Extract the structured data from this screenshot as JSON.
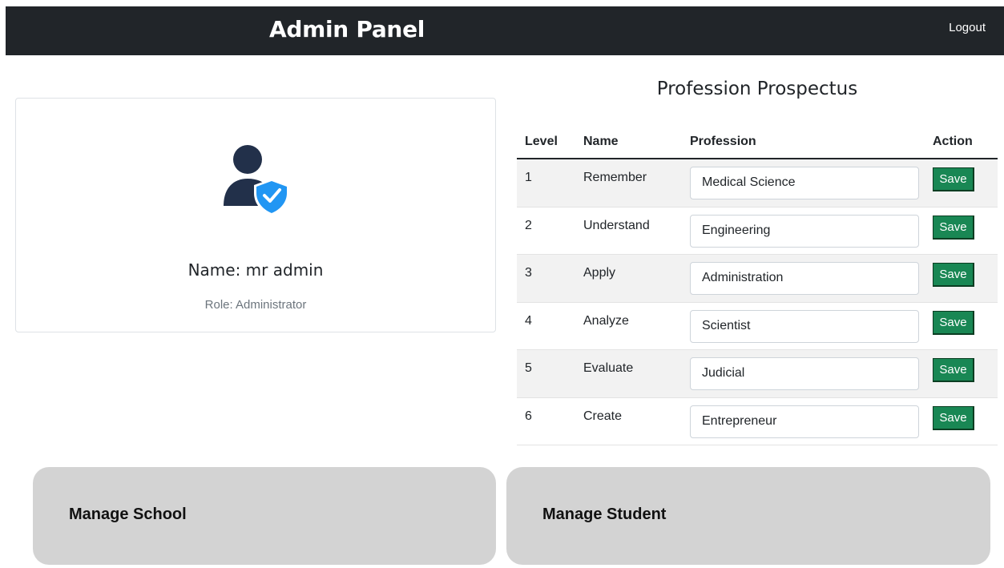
{
  "header": {
    "title": "Admin Panel",
    "logout_label": "Logout"
  },
  "profile": {
    "avatar_icon": "user-shield-icon",
    "name": "Name: mr admin",
    "role": "Role: Administrator"
  },
  "prospectus": {
    "title": "Profession Prospectus",
    "columns": {
      "level": "Level",
      "name": "Name",
      "profession": "Profession",
      "action": "Action"
    },
    "rows": [
      {
        "level": "1",
        "name": "Remember",
        "profession": "Medical Science",
        "action": "Save"
      },
      {
        "level": "2",
        "name": "Understand",
        "profession": "Engineering",
        "action": "Save"
      },
      {
        "level": "3",
        "name": "Apply",
        "profession": "Administration",
        "action": "Save"
      },
      {
        "level": "4",
        "name": "Analyze",
        "profession": "Scientist",
        "action": "Save"
      },
      {
        "level": "5",
        "name": "Evaluate",
        "profession": "Judicial",
        "action": "Save"
      },
      {
        "level": "6",
        "name": "Create",
        "profession": "Entrepreneur",
        "action": "Save"
      }
    ]
  },
  "manage": {
    "school_label": "Manage School",
    "student_label": "Manage Student"
  },
  "colors": {
    "topbar": "#212529",
    "save_button": "#198754",
    "card_gray": "#d3d3d3",
    "avatar_body": "#22304a",
    "shield": "#2196f3"
  }
}
